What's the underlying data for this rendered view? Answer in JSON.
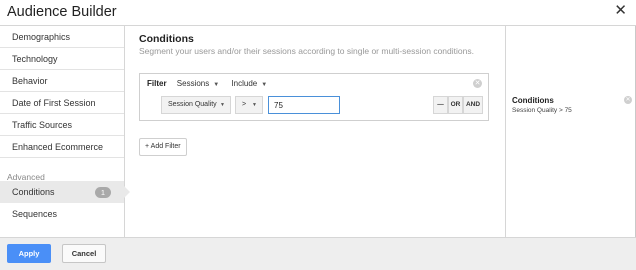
{
  "window": {
    "title": "Audience Builder",
    "close_icon": "close-icon"
  },
  "sidebar": {
    "items": [
      {
        "label": "Demographics"
      },
      {
        "label": "Technology"
      },
      {
        "label": "Behavior"
      },
      {
        "label": "Date of First Session"
      },
      {
        "label": "Traffic Sources"
      },
      {
        "label": "Enhanced Ecommerce"
      }
    ],
    "section_label": "Advanced",
    "advanced_items": [
      {
        "label": "Conditions",
        "count": "1",
        "active": true
      },
      {
        "label": "Sequences"
      }
    ]
  },
  "main": {
    "heading": "Conditions",
    "subheading": "Segment your users and/or their sessions according to single or multi-session conditions.",
    "filter": {
      "label": "Filter",
      "scope": "Sessions",
      "mode": "Include",
      "condition": {
        "dimension": "Session Quality",
        "operator": ">",
        "value": "75"
      },
      "logic_buttons": {
        "remove": "—",
        "or": "OR",
        "and": "AND"
      }
    },
    "add_filter_label": "+ Add Filter"
  },
  "summary": {
    "title": "Conditions",
    "detail": "Session Quality > 75"
  },
  "footer": {
    "apply_label": "Apply",
    "cancel_label": "Cancel"
  },
  "colors": {
    "accent": "#4a8ff7",
    "input_focus": "#4a90d9",
    "active_bg": "#e9e9e9",
    "badge": "#a9a9a9"
  }
}
